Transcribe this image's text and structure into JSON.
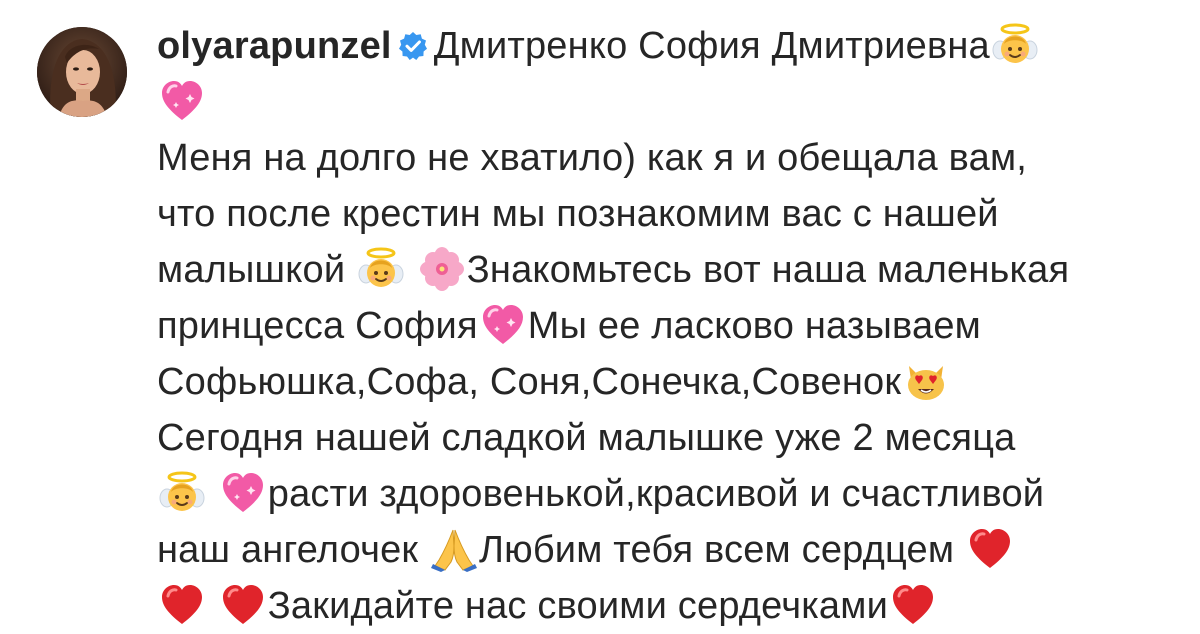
{
  "post": {
    "avatar_icon": "profile-avatar",
    "username": "olyarapunzel",
    "verified_icon": "verified-badge-icon",
    "colors": {
      "text": "#262626",
      "verified_blue": "#3897f0",
      "heart_red": "#e0242b",
      "heart_pink": "#f25aa6"
    },
    "caption_lines": [
      {
        "parts": [
          {
            "text": "Дмитренко София Дмитриевна"
          },
          {
            "emoji": "angel-face-icon"
          }
        ]
      },
      {
        "parts": [
          {
            "emoji": "sparkling-heart-icon"
          }
        ]
      },
      {
        "parts": [
          {
            "text": "Меня на долго не хватило) как я и обещала вам,"
          }
        ]
      },
      {
        "parts": [
          {
            "text": "что после крестин мы познакомим вас с нашей"
          }
        ]
      },
      {
        "parts": [
          {
            "text": "малышкой "
          },
          {
            "emoji": "angel-face-icon"
          },
          {
            "text": " "
          },
          {
            "emoji": "cherry-blossom-icon"
          },
          {
            "text": "Знакомьтесь вот наша маленькая"
          }
        ]
      },
      {
        "parts": [
          {
            "text": "принцесса София"
          },
          {
            "emoji": "sparkling-heart-icon"
          },
          {
            "text": "Мы ее ласково называем"
          }
        ]
      },
      {
        "parts": [
          {
            "text": "Софьюшка,Софа, Соня,Сонечка,Совенок"
          },
          {
            "emoji": "heart-eyes-cat-icon"
          }
        ]
      },
      {
        "parts": [
          {
            "text": "Сегодня нашей сладкой малышке уже 2 месяца"
          }
        ]
      },
      {
        "parts": [
          {
            "emoji": "angel-face-icon"
          },
          {
            "text": " "
          },
          {
            "emoji": "sparkling-heart-icon"
          },
          {
            "text": "расти здоровенькой,красивой и счастливой"
          }
        ]
      },
      {
        "parts": [
          {
            "text": "наш ангелочек "
          },
          {
            "emoji": "folded-hands-icon"
          },
          {
            "text": "Любим тебя всем сердцем "
          },
          {
            "emoji": "red-heart-icon"
          }
        ]
      },
      {
        "parts": [
          {
            "emoji": "red-heart-icon"
          },
          {
            "text": " "
          },
          {
            "emoji": "red-heart-icon"
          },
          {
            "text": "Закидайте нас своими сердечками"
          },
          {
            "emoji": "red-heart-icon"
          }
        ]
      }
    ]
  }
}
